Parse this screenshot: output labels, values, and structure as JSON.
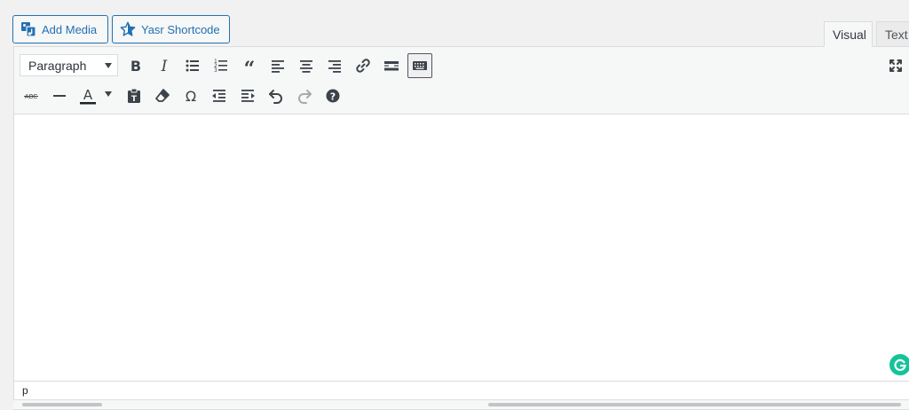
{
  "media_buttons": {
    "add_media": "Add Media",
    "yasr_shortcode": "Yasr Shortcode"
  },
  "tabs": {
    "visual": "Visual",
    "text": "Text"
  },
  "toolbar": {
    "format_select": "Paragraph",
    "row1_icons": [
      "bold-icon",
      "italic-icon",
      "bulleted-list-icon",
      "numbered-list-icon",
      "blockquote-icon",
      "align-left-icon",
      "align-center-icon",
      "align-right-icon",
      "link-icon",
      "read-more-icon",
      "toolbar-toggle-icon",
      "fullscreen-icon"
    ],
    "row2_icons": [
      "strikethrough-icon",
      "horizontal-line-icon",
      "text-color-icon",
      "paste-as-text-icon",
      "clear-formatting-icon",
      "special-character-icon",
      "decrease-indent-icon",
      "increase-indent-icon",
      "undo-icon",
      "redo-icon",
      "help-icon"
    ]
  },
  "status": {
    "path": "p"
  },
  "colors": {
    "accent": "#2271b1",
    "grammarly": "#15c39a"
  }
}
